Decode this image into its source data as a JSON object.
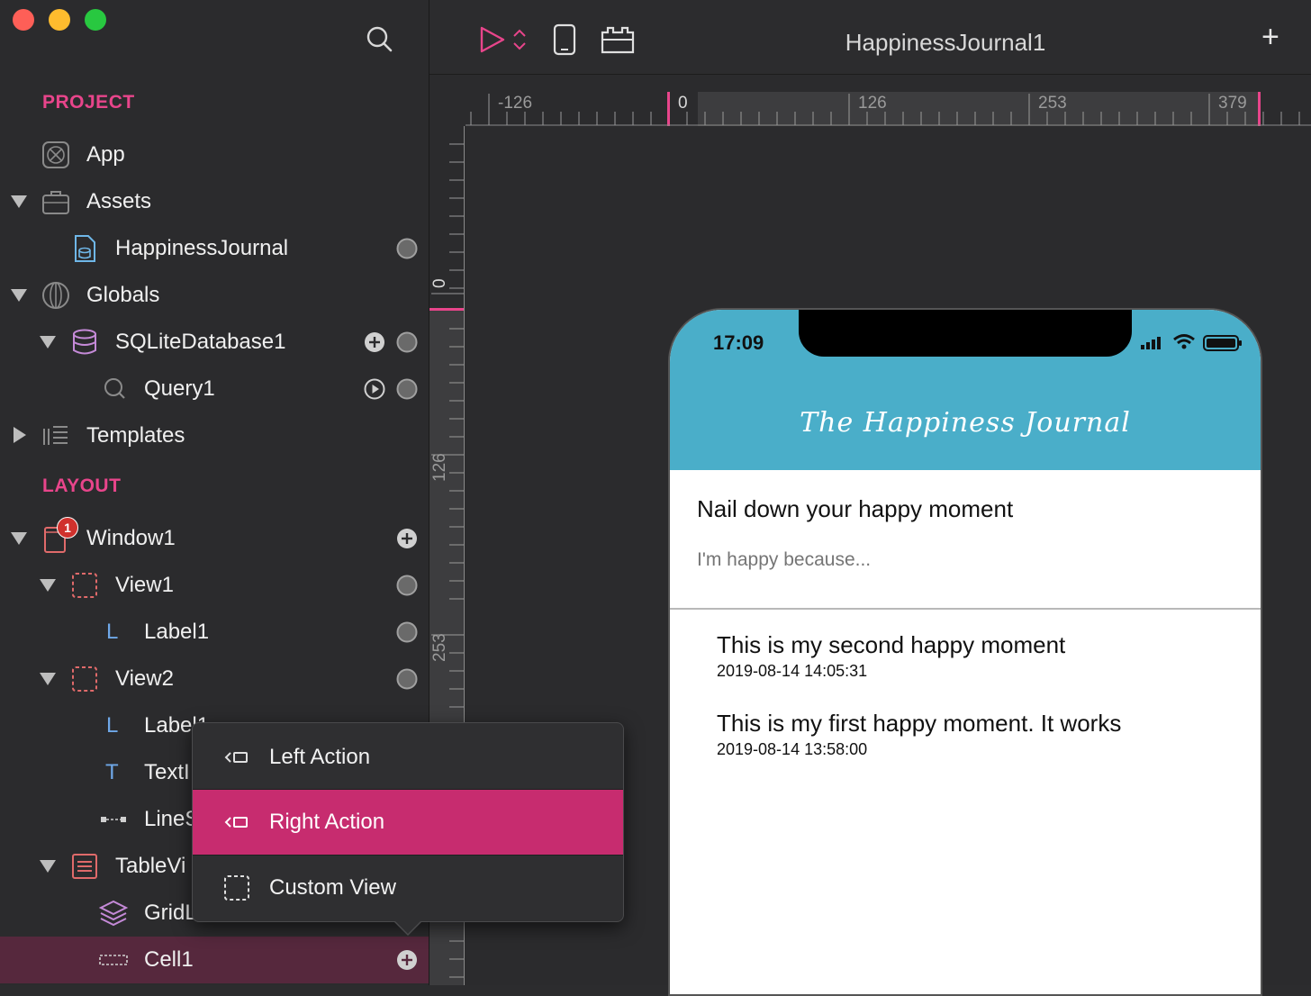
{
  "window": {
    "title": "HappinessJournal1"
  },
  "toolbar": {
    "add_label": "+"
  },
  "sidebar": {
    "project_header": "PROJECT",
    "layout_header": "LAYOUT",
    "items": [
      {
        "label": "App",
        "icon": "app-icon"
      },
      {
        "label": "Assets",
        "icon": "briefcase-icon"
      },
      {
        "label": "HappinessJournal",
        "icon": "database-file-icon"
      },
      {
        "label": "Globals",
        "icon": "globe-icon"
      },
      {
        "label": "SQLiteDatabase1",
        "icon": "database-icon"
      },
      {
        "label": "Query1",
        "icon": "search-icon"
      },
      {
        "label": "Templates",
        "icon": "templates-icon"
      },
      {
        "label": "Window1",
        "icon": "window-icon",
        "badge": "1"
      },
      {
        "label": "View1",
        "icon": "view-icon"
      },
      {
        "label": "Label1",
        "icon": "label-icon"
      },
      {
        "label": "View2",
        "icon": "view-icon"
      },
      {
        "label": "Label1",
        "icon": "label-icon"
      },
      {
        "label": "TextI",
        "icon": "text-icon"
      },
      {
        "label": "LineS",
        "icon": "line-icon"
      },
      {
        "label": "TableVi",
        "icon": "table-icon"
      },
      {
        "label": "GridL",
        "icon": "grid-icon"
      },
      {
        "label": "Cell1",
        "icon": "cell-icon"
      }
    ]
  },
  "rulers": {
    "h_ticks": [
      "-126",
      "0",
      "126",
      "253",
      "379"
    ],
    "v_ticks": [
      "0",
      "126",
      "253"
    ]
  },
  "phone": {
    "time": "17:09",
    "title": "The Happiness Journal",
    "prompt": "Nail down your happy moment",
    "placeholder": "I'm happy because...",
    "entries": [
      {
        "text": "This is my second happy moment",
        "date": "2019-08-14 14:05:31"
      },
      {
        "text": "This is my first happy moment. It works",
        "date": "2019-08-14 13:58:00"
      }
    ]
  },
  "popup": {
    "items": [
      {
        "label": "Left Action",
        "selected": false
      },
      {
        "label": "Right Action",
        "selected": true
      },
      {
        "label": "Custom View",
        "selected": false
      }
    ]
  },
  "colors": {
    "accent": "#e8458b",
    "selection": "#c72c6f",
    "header": "#4aaec9"
  }
}
